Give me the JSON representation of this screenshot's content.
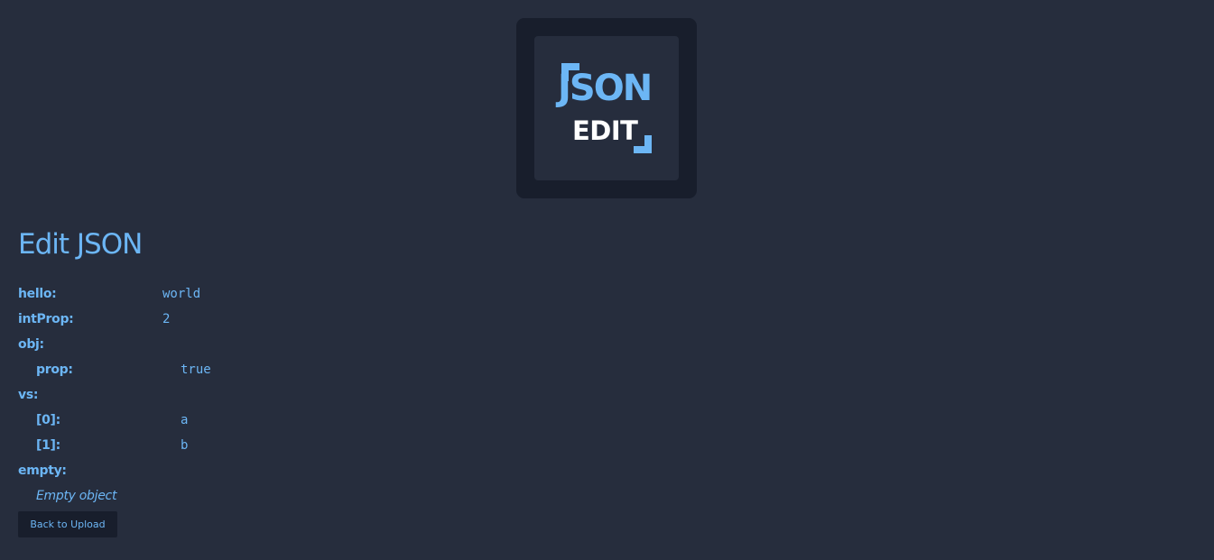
{
  "logo": {
    "word_top": "JSON",
    "word_bottom": "EDIT"
  },
  "page_title": "Edit JSON",
  "fields": {
    "hello": {
      "key": "hello:",
      "value": "world"
    },
    "intProp": {
      "key": "intProp:",
      "value": "2"
    },
    "obj": {
      "key": "obj:"
    },
    "obj_prop": {
      "key": "prop:",
      "value": "true"
    },
    "vs": {
      "key": "vs:"
    },
    "vs_0": {
      "key": "[0]:",
      "value": "a"
    },
    "vs_1": {
      "key": "[1]:",
      "value": "b"
    },
    "empty": {
      "key": "empty:",
      "note": "Empty object"
    }
  },
  "actions": {
    "back_label": "Back to Upload"
  },
  "colors": {
    "background": "#262d3d",
    "panel": "#181e2c",
    "accent": "#6cb6f5",
    "logo_text": "#ffffff"
  }
}
